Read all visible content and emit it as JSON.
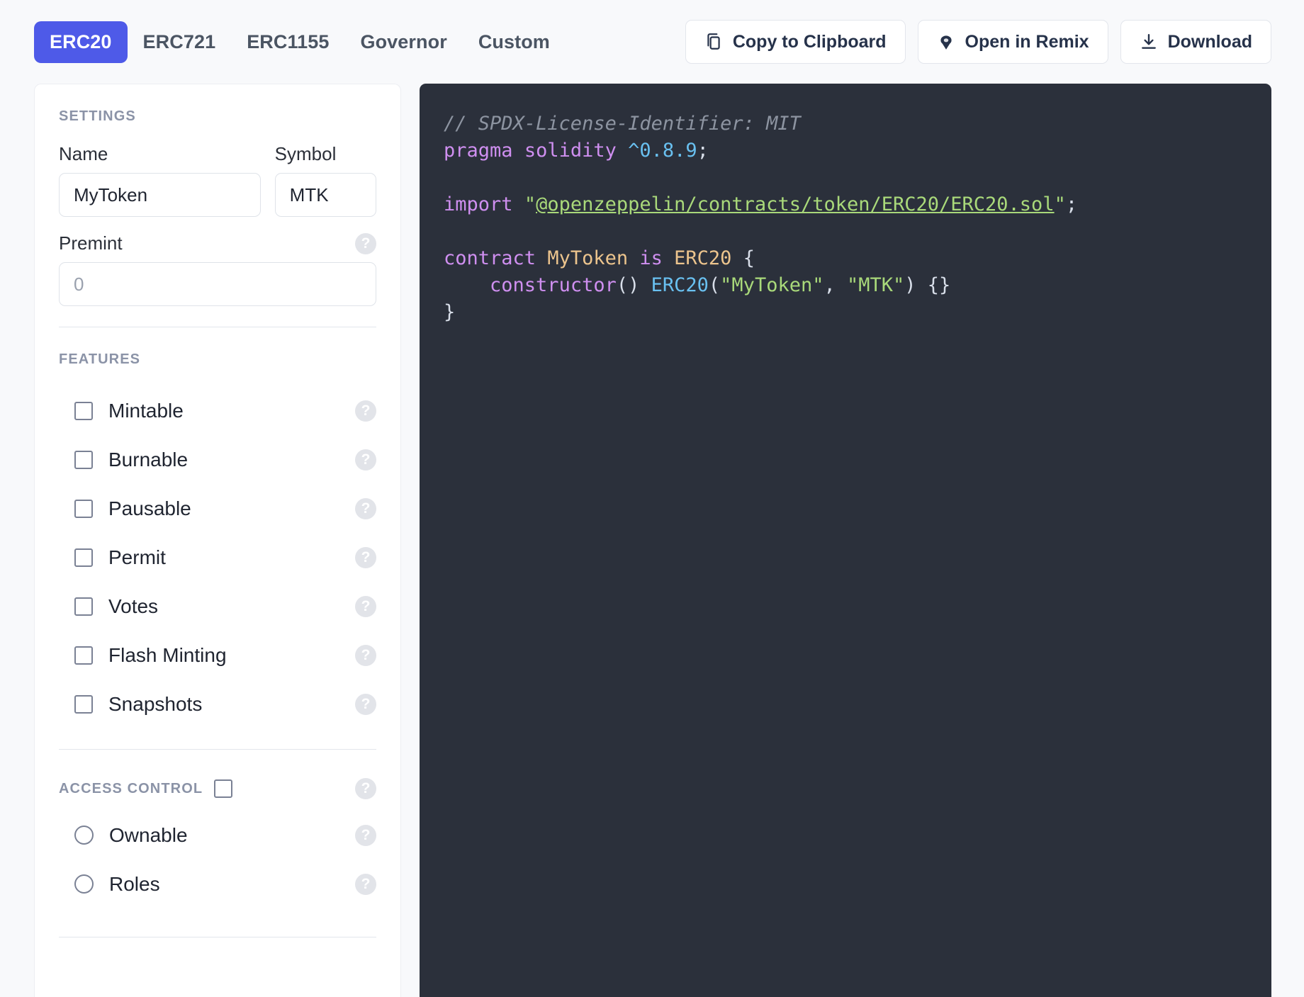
{
  "header": {
    "tabs": [
      {
        "label": "ERC20",
        "active": true
      },
      {
        "label": "ERC721",
        "active": false
      },
      {
        "label": "ERC1155",
        "active": false
      },
      {
        "label": "Governor",
        "active": false
      },
      {
        "label": "Custom",
        "active": false
      }
    ],
    "actions": [
      {
        "label": "Copy to Clipboard",
        "icon": "copy-icon"
      },
      {
        "label": "Open in Remix",
        "icon": "remix-icon"
      },
      {
        "label": "Download",
        "icon": "download-icon"
      }
    ]
  },
  "sidebar": {
    "settings_title": "SETTINGS",
    "name_label": "Name",
    "name_value": "MyToken",
    "symbol_label": "Symbol",
    "symbol_value": "MTK",
    "premint_label": "Premint",
    "premint_value": "",
    "premint_placeholder": "0",
    "features_title": "FEATURES",
    "features": [
      {
        "label": "Mintable",
        "checked": false
      },
      {
        "label": "Burnable",
        "checked": false
      },
      {
        "label": "Pausable",
        "checked": false
      },
      {
        "label": "Permit",
        "checked": false
      },
      {
        "label": "Votes",
        "checked": false
      },
      {
        "label": "Flash Minting",
        "checked": false
      },
      {
        "label": "Snapshots",
        "checked": false
      }
    ],
    "access_control_title": "ACCESS CONTROL",
    "access_control_checked": false,
    "access_options": [
      {
        "label": "Ownable",
        "selected": false
      },
      {
        "label": "Roles",
        "selected": false
      }
    ],
    "help_glyph": "?"
  },
  "code": {
    "lines": [
      {
        "tokens": [
          {
            "t": "// SPDX-License-Identifier: MIT",
            "c": "c-comment"
          }
        ]
      },
      {
        "tokens": [
          {
            "t": "pragma",
            "c": "c-keyword"
          },
          {
            "t": " ",
            "c": "c-plain"
          },
          {
            "t": "solidity",
            "c": "c-keyword"
          },
          {
            "t": " ",
            "c": "c-plain"
          },
          {
            "t": "^0.8.9",
            "c": "c-number"
          },
          {
            "t": ";",
            "c": "c-plain"
          }
        ]
      },
      {
        "tokens": []
      },
      {
        "tokens": [
          {
            "t": "import",
            "c": "c-keyword"
          },
          {
            "t": " ",
            "c": "c-plain"
          },
          {
            "t": "\"",
            "c": "c-string"
          },
          {
            "t": "@openzeppelin/contracts/token/ERC20/ERC20.sol",
            "c": "c-link"
          },
          {
            "t": "\"",
            "c": "c-string"
          },
          {
            "t": ";",
            "c": "c-plain"
          }
        ]
      },
      {
        "tokens": []
      },
      {
        "tokens": [
          {
            "t": "contract",
            "c": "c-keyword"
          },
          {
            "t": " ",
            "c": "c-plain"
          },
          {
            "t": "MyToken",
            "c": "c-type"
          },
          {
            "t": " ",
            "c": "c-plain"
          },
          {
            "t": "is",
            "c": "c-keyword"
          },
          {
            "t": " ",
            "c": "c-plain"
          },
          {
            "t": "ERC20",
            "c": "c-type"
          },
          {
            "t": " {",
            "c": "c-plain"
          }
        ]
      },
      {
        "tokens": [
          {
            "t": "    ",
            "c": "c-plain"
          },
          {
            "t": "constructor",
            "c": "c-keyword"
          },
          {
            "t": "() ",
            "c": "c-plain"
          },
          {
            "t": "ERC20",
            "c": "c-fn"
          },
          {
            "t": "(",
            "c": "c-plain"
          },
          {
            "t": "\"MyToken\"",
            "c": "c-string"
          },
          {
            "t": ", ",
            "c": "c-plain"
          },
          {
            "t": "\"MTK\"",
            "c": "c-string"
          },
          {
            "t": ") {}",
            "c": "c-plain"
          }
        ]
      },
      {
        "tokens": [
          {
            "t": "}",
            "c": "c-plain"
          }
        ]
      }
    ]
  },
  "colors": {
    "accent": "#4e5ae8",
    "page_bg": "#f8f9fb",
    "code_bg": "#2b303b",
    "text_dark": "#26324a",
    "muted": "#8b93a7"
  }
}
